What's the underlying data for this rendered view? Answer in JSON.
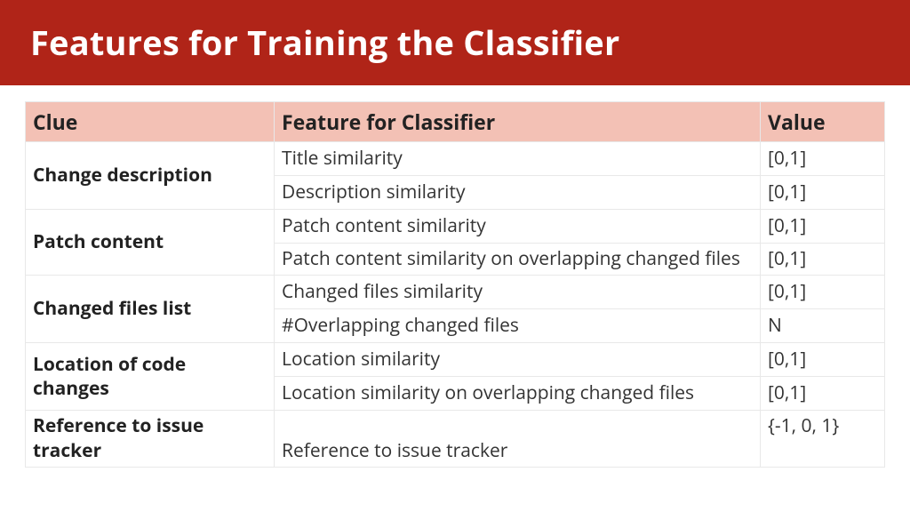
{
  "header": {
    "title": "Features for Training the Classifier"
  },
  "table": {
    "headers": {
      "clue": "Clue",
      "feature": "Feature for Classifier",
      "value": "Value"
    },
    "groups": [
      {
        "clue": "Change description",
        "rows": [
          {
            "feature": "Title similarity",
            "value": "[0,1]"
          },
          {
            "feature": "Description similarity",
            "value": "[0,1]"
          }
        ]
      },
      {
        "clue": "Patch content",
        "rows": [
          {
            "feature": "Patch content similarity",
            "value": "[0,1]"
          },
          {
            "feature": "Patch content similarity on overlapping changed files",
            "value": "[0,1]"
          }
        ]
      },
      {
        "clue": "Changed files list",
        "rows": [
          {
            "feature": "Changed files similarity",
            "value": "[0,1]"
          },
          {
            "feature": "#Overlapping changed files",
            "value": "N"
          }
        ]
      },
      {
        "clue": "Location of code changes",
        "rows": [
          {
            "feature": "Location similarity",
            "value": "[0,1]"
          },
          {
            "feature": "Location similarity on overlapping changed files",
            "value": "[0,1]"
          }
        ]
      },
      {
        "clue": "Reference to issue tracker",
        "rows": [
          {
            "feature": "Reference to issue tracker",
            "value": "{-1, 0, 1}"
          }
        ]
      }
    ]
  }
}
